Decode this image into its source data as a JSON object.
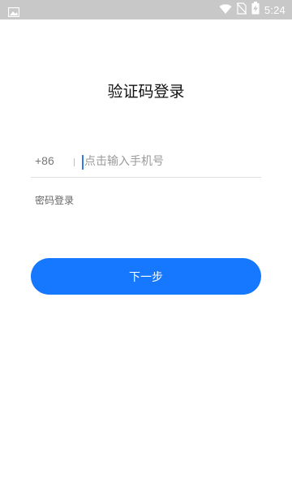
{
  "status_bar": {
    "time": "5:24",
    "icons": [
      "image-icon",
      "wifi-icon",
      "no-sim-icon",
      "battery-charging-icon"
    ]
  },
  "page": {
    "title": "验证码登录"
  },
  "phone": {
    "country_code": "+86",
    "placeholder": "点击输入手机号",
    "value": ""
  },
  "links": {
    "password_login": "密码登录"
  },
  "actions": {
    "next_label": "下一步"
  },
  "colors": {
    "primary": "#1677ff",
    "status_bar": "#c8c8c8"
  }
}
